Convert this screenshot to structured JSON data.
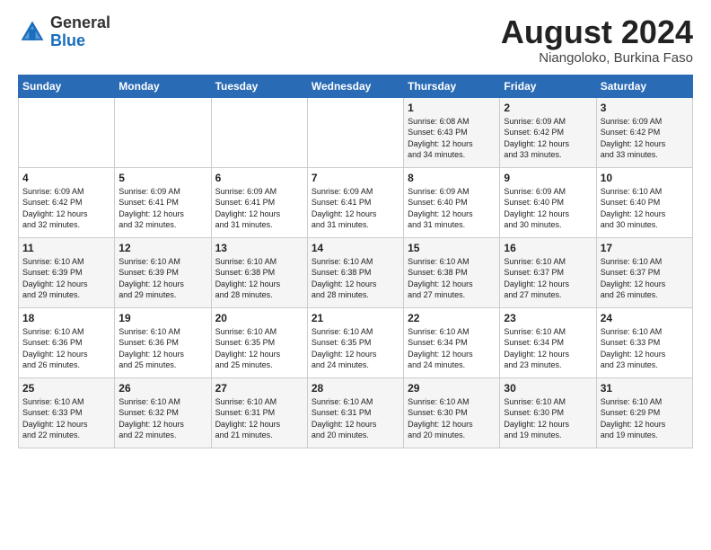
{
  "header": {
    "logo_general": "General",
    "logo_blue": "Blue",
    "month_year": "August 2024",
    "location": "Niangoloko, Burkina Faso"
  },
  "days_of_week": [
    "Sunday",
    "Monday",
    "Tuesday",
    "Wednesday",
    "Thursday",
    "Friday",
    "Saturday"
  ],
  "weeks": [
    [
      {
        "day": "",
        "info": ""
      },
      {
        "day": "",
        "info": ""
      },
      {
        "day": "",
        "info": ""
      },
      {
        "day": "",
        "info": ""
      },
      {
        "day": "1",
        "info": "Sunrise: 6:08 AM\nSunset: 6:43 PM\nDaylight: 12 hours\nand 34 minutes."
      },
      {
        "day": "2",
        "info": "Sunrise: 6:09 AM\nSunset: 6:42 PM\nDaylight: 12 hours\nand 33 minutes."
      },
      {
        "day": "3",
        "info": "Sunrise: 6:09 AM\nSunset: 6:42 PM\nDaylight: 12 hours\nand 33 minutes."
      }
    ],
    [
      {
        "day": "4",
        "info": "Sunrise: 6:09 AM\nSunset: 6:42 PM\nDaylight: 12 hours\nand 32 minutes."
      },
      {
        "day": "5",
        "info": "Sunrise: 6:09 AM\nSunset: 6:41 PM\nDaylight: 12 hours\nand 32 minutes."
      },
      {
        "day": "6",
        "info": "Sunrise: 6:09 AM\nSunset: 6:41 PM\nDaylight: 12 hours\nand 31 minutes."
      },
      {
        "day": "7",
        "info": "Sunrise: 6:09 AM\nSunset: 6:41 PM\nDaylight: 12 hours\nand 31 minutes."
      },
      {
        "day": "8",
        "info": "Sunrise: 6:09 AM\nSunset: 6:40 PM\nDaylight: 12 hours\nand 31 minutes."
      },
      {
        "day": "9",
        "info": "Sunrise: 6:09 AM\nSunset: 6:40 PM\nDaylight: 12 hours\nand 30 minutes."
      },
      {
        "day": "10",
        "info": "Sunrise: 6:10 AM\nSunset: 6:40 PM\nDaylight: 12 hours\nand 30 minutes."
      }
    ],
    [
      {
        "day": "11",
        "info": "Sunrise: 6:10 AM\nSunset: 6:39 PM\nDaylight: 12 hours\nand 29 minutes."
      },
      {
        "day": "12",
        "info": "Sunrise: 6:10 AM\nSunset: 6:39 PM\nDaylight: 12 hours\nand 29 minutes."
      },
      {
        "day": "13",
        "info": "Sunrise: 6:10 AM\nSunset: 6:38 PM\nDaylight: 12 hours\nand 28 minutes."
      },
      {
        "day": "14",
        "info": "Sunrise: 6:10 AM\nSunset: 6:38 PM\nDaylight: 12 hours\nand 28 minutes."
      },
      {
        "day": "15",
        "info": "Sunrise: 6:10 AM\nSunset: 6:38 PM\nDaylight: 12 hours\nand 27 minutes."
      },
      {
        "day": "16",
        "info": "Sunrise: 6:10 AM\nSunset: 6:37 PM\nDaylight: 12 hours\nand 27 minutes."
      },
      {
        "day": "17",
        "info": "Sunrise: 6:10 AM\nSunset: 6:37 PM\nDaylight: 12 hours\nand 26 minutes."
      }
    ],
    [
      {
        "day": "18",
        "info": "Sunrise: 6:10 AM\nSunset: 6:36 PM\nDaylight: 12 hours\nand 26 minutes."
      },
      {
        "day": "19",
        "info": "Sunrise: 6:10 AM\nSunset: 6:36 PM\nDaylight: 12 hours\nand 25 minutes."
      },
      {
        "day": "20",
        "info": "Sunrise: 6:10 AM\nSunset: 6:35 PM\nDaylight: 12 hours\nand 25 minutes."
      },
      {
        "day": "21",
        "info": "Sunrise: 6:10 AM\nSunset: 6:35 PM\nDaylight: 12 hours\nand 24 minutes."
      },
      {
        "day": "22",
        "info": "Sunrise: 6:10 AM\nSunset: 6:34 PM\nDaylight: 12 hours\nand 24 minutes."
      },
      {
        "day": "23",
        "info": "Sunrise: 6:10 AM\nSunset: 6:34 PM\nDaylight: 12 hours\nand 23 minutes."
      },
      {
        "day": "24",
        "info": "Sunrise: 6:10 AM\nSunset: 6:33 PM\nDaylight: 12 hours\nand 23 minutes."
      }
    ],
    [
      {
        "day": "25",
        "info": "Sunrise: 6:10 AM\nSunset: 6:33 PM\nDaylight: 12 hours\nand 22 minutes."
      },
      {
        "day": "26",
        "info": "Sunrise: 6:10 AM\nSunset: 6:32 PM\nDaylight: 12 hours\nand 22 minutes."
      },
      {
        "day": "27",
        "info": "Sunrise: 6:10 AM\nSunset: 6:31 PM\nDaylight: 12 hours\nand 21 minutes."
      },
      {
        "day": "28",
        "info": "Sunrise: 6:10 AM\nSunset: 6:31 PM\nDaylight: 12 hours\nand 20 minutes."
      },
      {
        "day": "29",
        "info": "Sunrise: 6:10 AM\nSunset: 6:30 PM\nDaylight: 12 hours\nand 20 minutes."
      },
      {
        "day": "30",
        "info": "Sunrise: 6:10 AM\nSunset: 6:30 PM\nDaylight: 12 hours\nand 19 minutes."
      },
      {
        "day": "31",
        "info": "Sunrise: 6:10 AM\nSunset: 6:29 PM\nDaylight: 12 hours\nand 19 minutes."
      }
    ]
  ]
}
